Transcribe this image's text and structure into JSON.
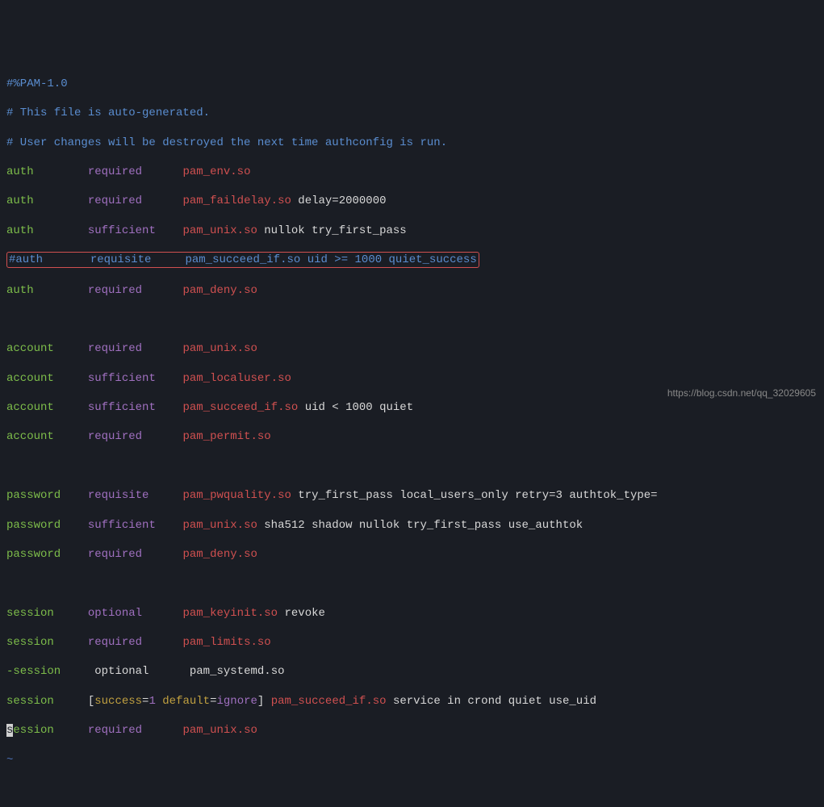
{
  "header": {
    "l1": "#%PAM-1.0",
    "l2": "# This file is auto-generated.",
    "l3": "# User changes will be destroyed the next time authconfig is run."
  },
  "rows": {
    "r0": {
      "type": "auth",
      "ctrl": "required",
      "mod": "pam_env.so",
      "args": ""
    },
    "r1": {
      "type": "auth",
      "ctrl": "required",
      "mod": "pam_faildelay.so",
      "args": "delay=2000000"
    },
    "r2": {
      "type": "auth",
      "ctrl": "sufficient",
      "mod": "pam_unix.so",
      "args": "nullok try_first_pass"
    },
    "r3": {
      "type": "#auth",
      "ctrl": "requisite",
      "mod": "pam_succeed_if.so",
      "args": "uid >= 1000 quiet_success"
    },
    "r4": {
      "type": "auth",
      "ctrl": "required",
      "mod": "pam_deny.so",
      "args": ""
    },
    "r5": {
      "type": "account",
      "ctrl": "required",
      "mod": "pam_unix.so",
      "args": ""
    },
    "r6": {
      "type": "account",
      "ctrl": "sufficient",
      "mod": "pam_localuser.so",
      "args": ""
    },
    "r7": {
      "type": "account",
      "ctrl": "sufficient",
      "mod": "pam_succeed_if.so",
      "args": "uid < 1000 quiet"
    },
    "r8": {
      "type": "account",
      "ctrl": "required",
      "mod": "pam_permit.so",
      "args": ""
    },
    "r9": {
      "type": "password",
      "ctrl": "requisite",
      "mod": "pam_pwquality.so",
      "args": "try_first_pass local_users_only retry=3 authtok_type="
    },
    "r10": {
      "type": "password",
      "ctrl": "sufficient",
      "mod": "pam_unix.so",
      "args": "sha512 shadow nullok try_first_pass use_authtok"
    },
    "r11": {
      "type": "password",
      "ctrl": "required",
      "mod": "pam_deny.so",
      "args": ""
    },
    "r12": {
      "type": "session",
      "ctrl": "optional",
      "mod": "pam_keyinit.so",
      "args": "revoke"
    },
    "r13": {
      "type": "session",
      "ctrl": "required",
      "mod": "pam_limits.so",
      "args": ""
    },
    "r14": {
      "type": "-session",
      "ctrl": "optional",
      "mod": "pam_systemd.so",
      "args": ""
    },
    "r15": {
      "type": "session",
      "bo": "[",
      "s1": "success",
      "eq1": "=",
      "v1": "1",
      "sp": " ",
      "s2": "default",
      "eq2": "=",
      "v2": "ignore",
      "bc": "]",
      "mod": "pam_succeed_if.so",
      "args": "service in crond quiet use_uid"
    },
    "r16": {
      "cur": "s",
      "rest": "ession",
      "ctrl": "required",
      "mod": "pam_unix.so",
      "args": ""
    }
  },
  "tilde": "~",
  "watermark": "https://blog.csdn.net/qq_32029605"
}
